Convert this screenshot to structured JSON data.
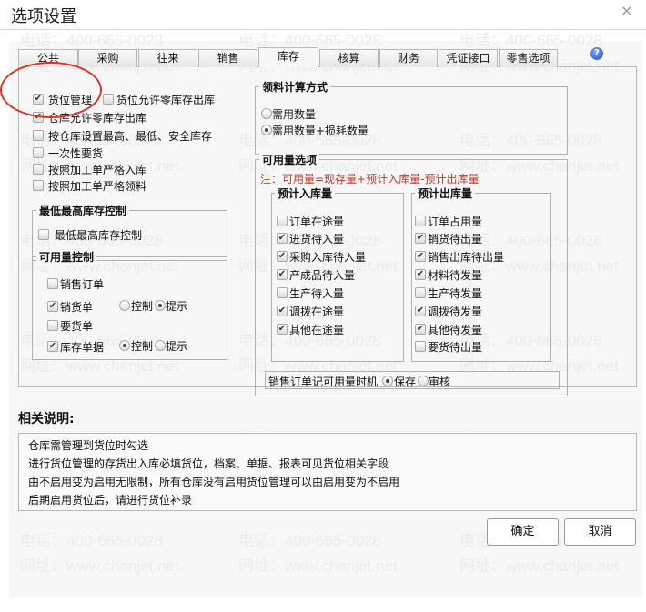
{
  "window": {
    "title": "选项设置",
    "close": "×"
  },
  "watermark": {
    "phone": "电话：400-665-0028",
    "site": "网址：www.chanjet.net"
  },
  "tabs": [
    {
      "label": "公共"
    },
    {
      "label": "采购"
    },
    {
      "label": "往来"
    },
    {
      "label": "销售"
    },
    {
      "label": "库存",
      "active": true
    },
    {
      "label": "核算"
    },
    {
      "label": "财务"
    },
    {
      "label": "凭证接口"
    },
    {
      "label": "零售选项"
    }
  ],
  "help_icon": "?",
  "left_options": [
    {
      "label": "货位管理",
      "checked": true
    },
    {
      "label": "货位允许零库存出库",
      "checked": false
    },
    {
      "label": "仓库允许零库存出库",
      "checked": true
    },
    {
      "label": "按仓库设置最高、最低、安全库存",
      "checked": false
    },
    {
      "label": "一次性要货",
      "checked": false
    },
    {
      "label": "按照加工单严格入库",
      "checked": false
    },
    {
      "label": "按照加工单严格领料",
      "checked": false
    }
  ],
  "min_max": {
    "title": "最低最高库存控制",
    "option": {
      "label": "最低最高库存控制",
      "checked": false
    }
  },
  "available_control": {
    "title": "可用量控制",
    "rows": [
      {
        "label": "销售订单",
        "checked": false
      },
      {
        "label": "销货单",
        "checked": true,
        "mode": "提示"
      },
      {
        "label": "要货单",
        "checked": false
      },
      {
        "label": "库存单据",
        "checked": true,
        "mode": "控制"
      }
    ],
    "radio_control": "控制",
    "radio_hint": "提示"
  },
  "material_calc": {
    "title": "领料计算方式",
    "options": [
      {
        "label": "需用数量",
        "selected": false
      },
      {
        "label": "需用数量+损耗数量",
        "selected": true
      }
    ]
  },
  "available_options": {
    "title": "可用量选项",
    "note": "注：可用量=现存量+预计入库量-预计出库量",
    "inbound": {
      "title": "预计入库量",
      "items": [
        {
          "label": "订单在途量",
          "checked": false
        },
        {
          "label": "进货待入量",
          "checked": true
        },
        {
          "label": "采购入库待入量",
          "checked": true
        },
        {
          "label": "产成品待入量",
          "checked": true
        },
        {
          "label": "生产待入量",
          "checked": false
        },
        {
          "label": "调拨在途量",
          "checked": true
        },
        {
          "label": "其他在途量",
          "checked": true
        }
      ]
    },
    "outbound": {
      "title": "预计出库量",
      "items": [
        {
          "label": "订单占用量",
          "checked": false
        },
        {
          "label": "销货待出量",
          "checked": true
        },
        {
          "label": "销售出库待出量",
          "checked": true
        },
        {
          "label": "材料待发量",
          "checked": true
        },
        {
          "label": "生产待发量",
          "checked": false
        },
        {
          "label": "调拨待发量",
          "checked": true
        },
        {
          "label": "其他待发量",
          "checked": true
        },
        {
          "label": "要货待出量",
          "checked": false
        }
      ]
    },
    "timing": {
      "label": "销售订单记可用量时机",
      "options": [
        {
          "label": "保存",
          "selected": true
        },
        {
          "label": "审核",
          "selected": false
        }
      ]
    }
  },
  "description": {
    "title": "相关说明:",
    "lines": [
      "仓库需管理到货位时勾选",
      "进行货位管理的存货出入库必填货位，档案、单据、报表可见货位相关字段",
      "由不启用变为启用无限制，所有仓库没有启用货位管理可以由启用变为不启用",
      "后期启用货位后，请进行货位补录"
    ]
  },
  "buttons": {
    "ok": "确定",
    "cancel": "取消"
  },
  "colors": {
    "note": "#c0392b",
    "highlight_ellipse": "#e0302a"
  }
}
